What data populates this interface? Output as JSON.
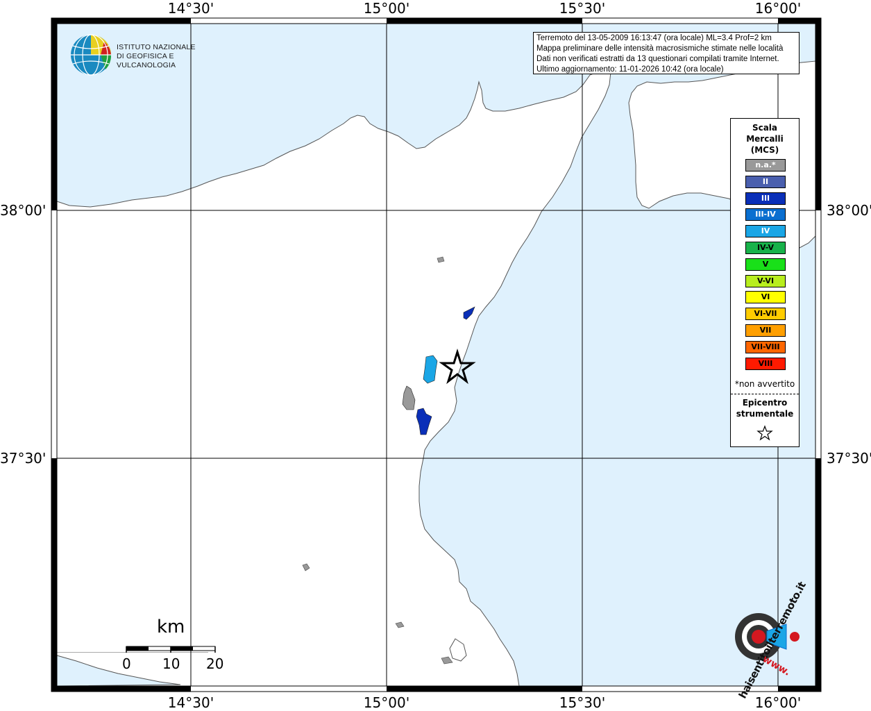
{
  "colors": {
    "sea": "#dff1fd",
    "land": "#ffffff",
    "coast": "#555555",
    "grid": "#000000",
    "frame": "#000000"
  },
  "map": {
    "ticks_top": [
      "14°30'",
      "15°00'",
      "15°30'",
      "16°00'"
    ],
    "ticks_bottom": [
      "14°30'",
      "15°00'",
      "15°30'",
      "16°00'"
    ],
    "ticks_left": [
      "38°00'",
      "37°30'"
    ],
    "ticks_right": [
      "38°00'",
      "37°30'"
    ]
  },
  "institute_logo": {
    "line1": "ISTITUTO NAZIONALE",
    "line2": "DI GEOFISICA E VULCANOLOGIA"
  },
  "info": {
    "line1": "Terremoto del 13-05-2009 16:13:47 (ora locale) ML=3.4 Prof=2 km",
    "line2": "Mappa preliminare delle intensità macrosismiche stimate nelle località",
    "line3": "Dati non verificati estratti da 13 questionari compilati tramite Internet.",
    "line4": "Ultimo aggiornamento: 11-01-2026 10:42 (ora locale)"
  },
  "legend": {
    "title1": "Scala",
    "title2": "Mercalli",
    "title3": "(MCS)",
    "classes": [
      {
        "label": "n.a.*",
        "color": "#999999",
        "text": "#ffffff"
      },
      {
        "label": "II",
        "color": "#4a5fae",
        "text": "#ffffff"
      },
      {
        "label": "III",
        "color": "#0a2fb8",
        "text": "#ffffff"
      },
      {
        "label": "III-IV",
        "color": "#0a6fd0",
        "text": "#ffffff"
      },
      {
        "label": "IV",
        "color": "#1aa6e6",
        "text": "#ffffff"
      },
      {
        "label": "IV-V",
        "color": "#18b24a",
        "text": "#000000"
      },
      {
        "label": "V",
        "color": "#19e019",
        "text": "#000000"
      },
      {
        "label": "V-VI",
        "color": "#b8ee1e",
        "text": "#000000"
      },
      {
        "label": "VI",
        "color": "#ffff00",
        "text": "#000000"
      },
      {
        "label": "VI-VII",
        "color": "#ffcc00",
        "text": "#000000"
      },
      {
        "label": "VII",
        "color": "#ff9f00",
        "text": "#000000"
      },
      {
        "label": "VII-VIII",
        "color": "#ff6600",
        "text": "#000000"
      },
      {
        "label": "VIII",
        "color": "#ff1a00",
        "text": "#000000"
      }
    ],
    "note": "*non avvertito",
    "epicentre1": "Epicentro",
    "epicentre2": "strumentale"
  },
  "scale": {
    "unit": "km",
    "labels": [
      "0",
      "10",
      "20"
    ]
  },
  "website_logo": {
    "text": "haisentitoilterremoto.it",
    "prefix": "www."
  }
}
